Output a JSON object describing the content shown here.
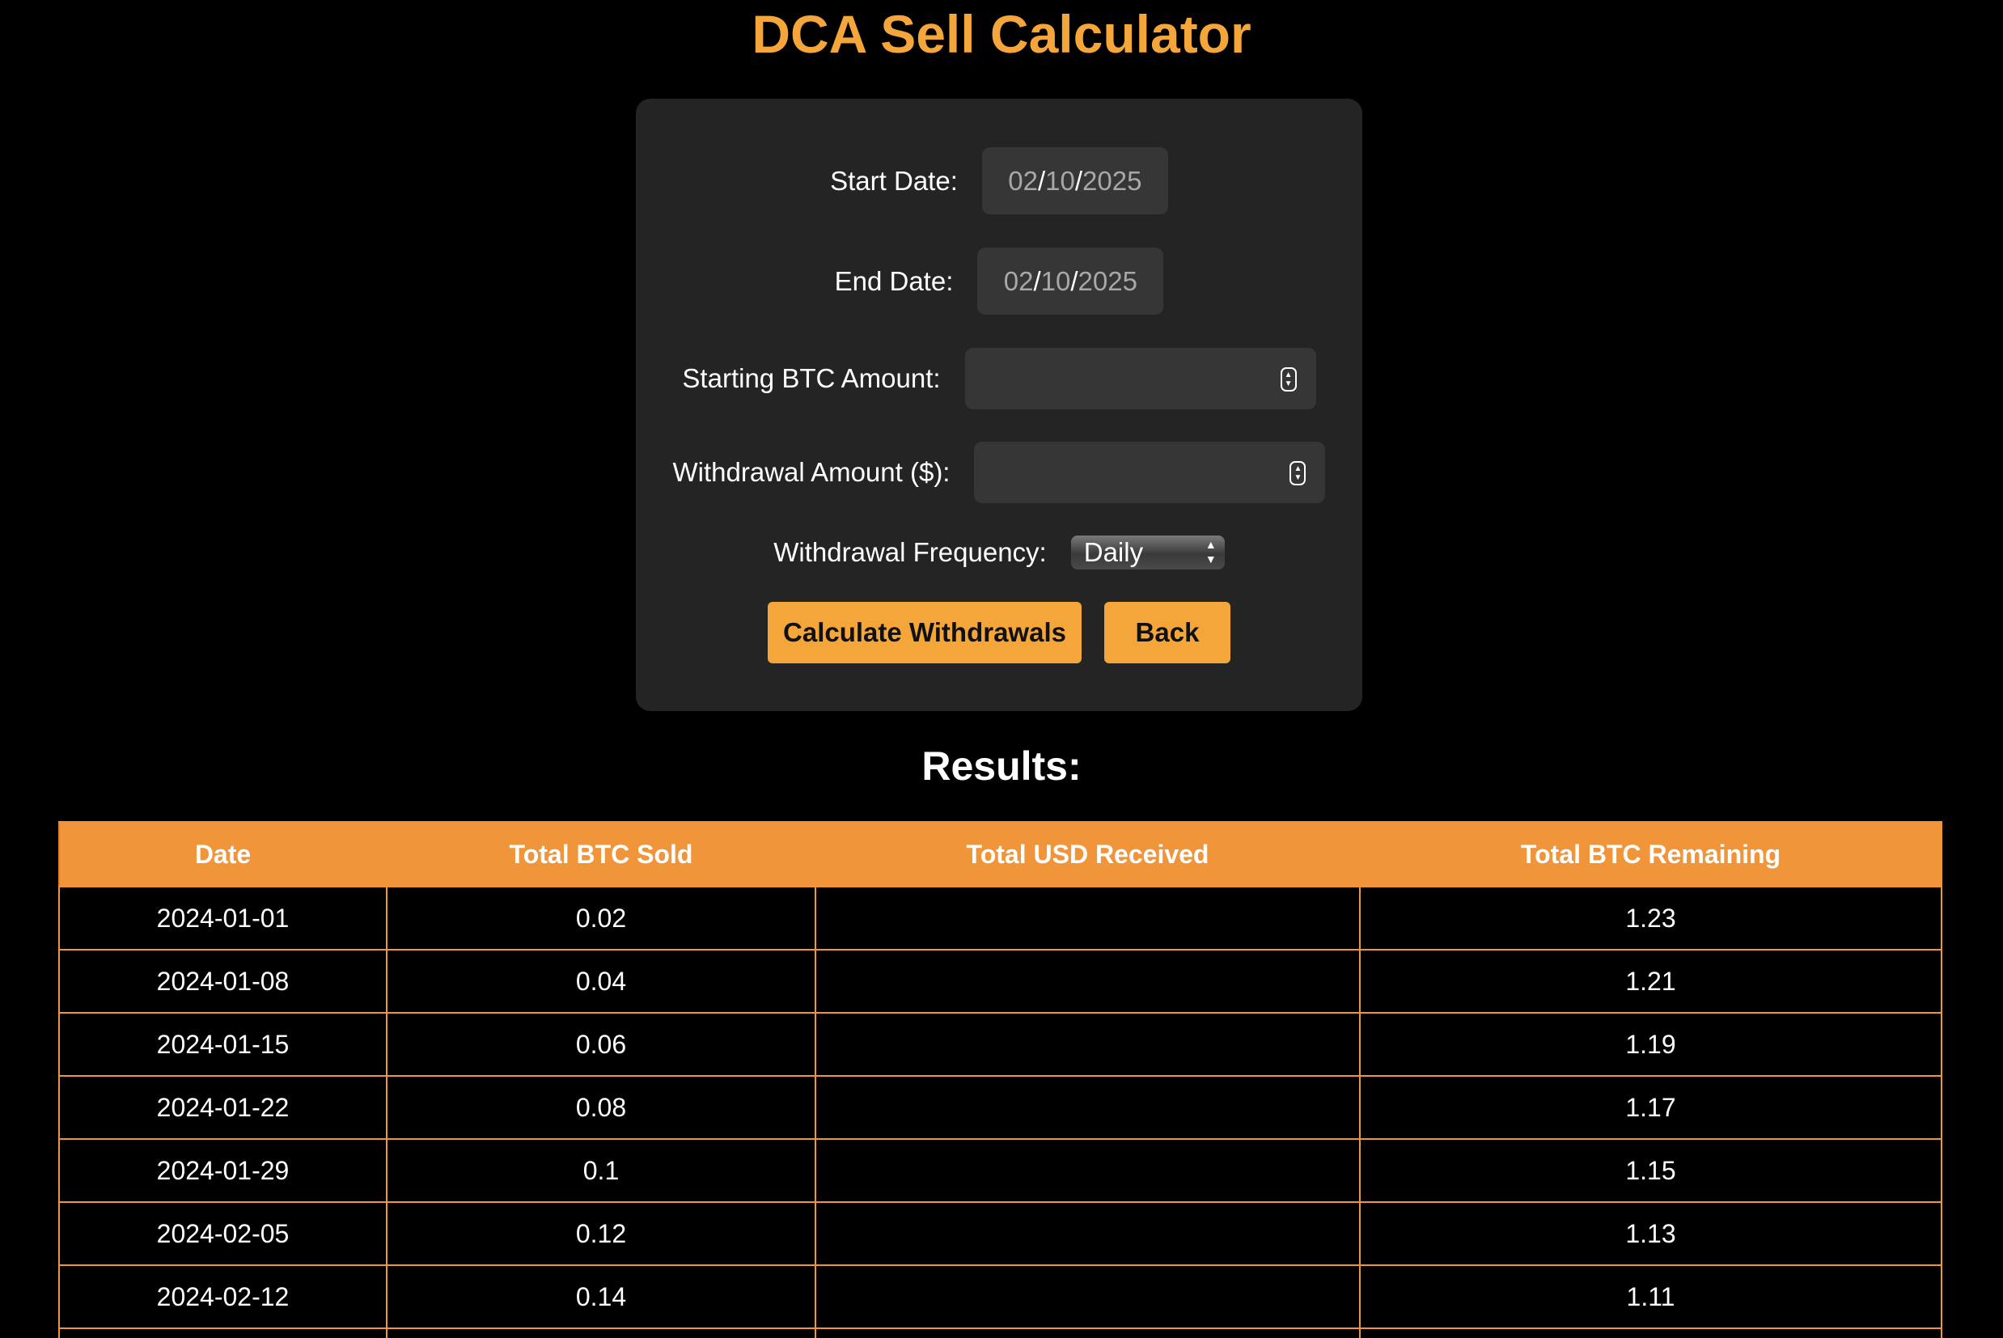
{
  "page": {
    "title": "DCA Sell Calculator",
    "results_title": "Results:"
  },
  "colors": {
    "accent": "#f5a63a",
    "table_header": "#f0953a",
    "card_bg": "#242424",
    "input_bg": "#363636",
    "page_bg": "#000000"
  },
  "form": {
    "start_date": {
      "label": "Start Date:",
      "month": "02",
      "day": "10",
      "year": "2025"
    },
    "end_date": {
      "label": "End Date:",
      "month": "02",
      "day": "10",
      "year": "2025"
    },
    "starting_btc": {
      "label": "Starting BTC Amount:",
      "value": ""
    },
    "withdrawal_amount": {
      "label": "Withdrawal Amount ($):",
      "value": ""
    },
    "frequency": {
      "label": "Withdrawal Frequency:",
      "selected": "Daily"
    },
    "buttons": {
      "calculate": "Calculate Withdrawals",
      "back": "Back"
    }
  },
  "table": {
    "columns": [
      "Date",
      "Total BTC Sold",
      "Total USD Received",
      "Total BTC Remaining"
    ],
    "rows": [
      [
        "2024-01-01",
        "0.02",
        "",
        "1.23"
      ],
      [
        "2024-01-08",
        "0.04",
        "",
        "1.21"
      ],
      [
        "2024-01-15",
        "0.06",
        "",
        "1.19"
      ],
      [
        "2024-01-22",
        "0.08",
        "",
        "1.17"
      ],
      [
        "2024-01-29",
        "0.1",
        "",
        "1.15"
      ],
      [
        "2024-02-05",
        "0.12",
        "",
        "1.13"
      ],
      [
        "2024-02-12",
        "0.14",
        "",
        "1.11"
      ],
      [
        "",
        "",
        "",
        ""
      ]
    ]
  }
}
